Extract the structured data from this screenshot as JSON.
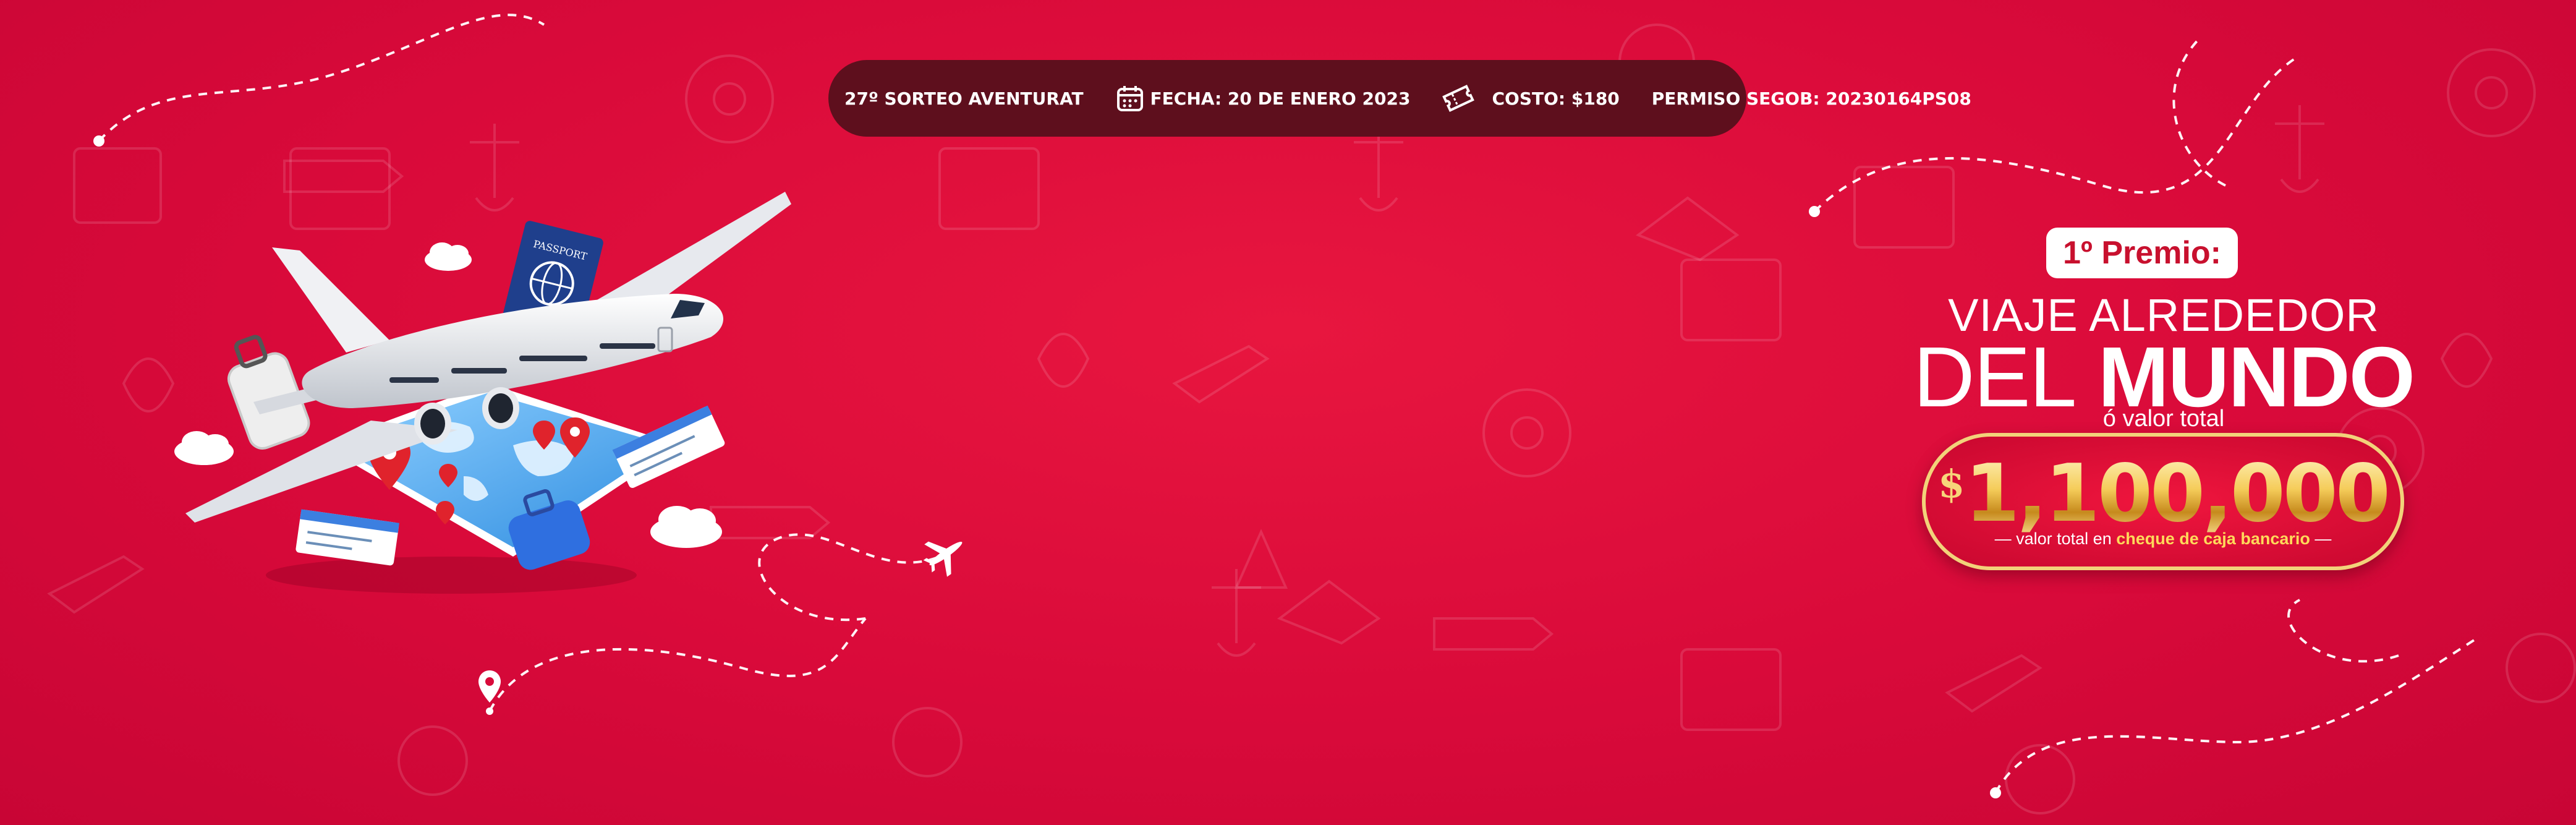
{
  "banner": {
    "background_color": "#d90a3a",
    "infobar": {
      "edition": "27º SORTEO AVENTURAT",
      "date": "FECHA: 20 DE ENERO 2023",
      "cost": "COSTO: $180",
      "permit": "PERMISO SEGOB: 20230164PS08"
    },
    "prize": {
      "badge": "1º Premio:",
      "line1": "VIAJE ALREDEDOR",
      "line2_a": "DEL",
      "line2_b": "MUNDO",
      "line3": "ó valor total",
      "currency": "$",
      "amount": "1,100,000",
      "note_prefix": "valor total en",
      "note_highlight": "cheque de caja bancario",
      "gold_color": "#f5cc5a"
    },
    "illustration": {
      "passport_text": "PASSPORT"
    }
  }
}
